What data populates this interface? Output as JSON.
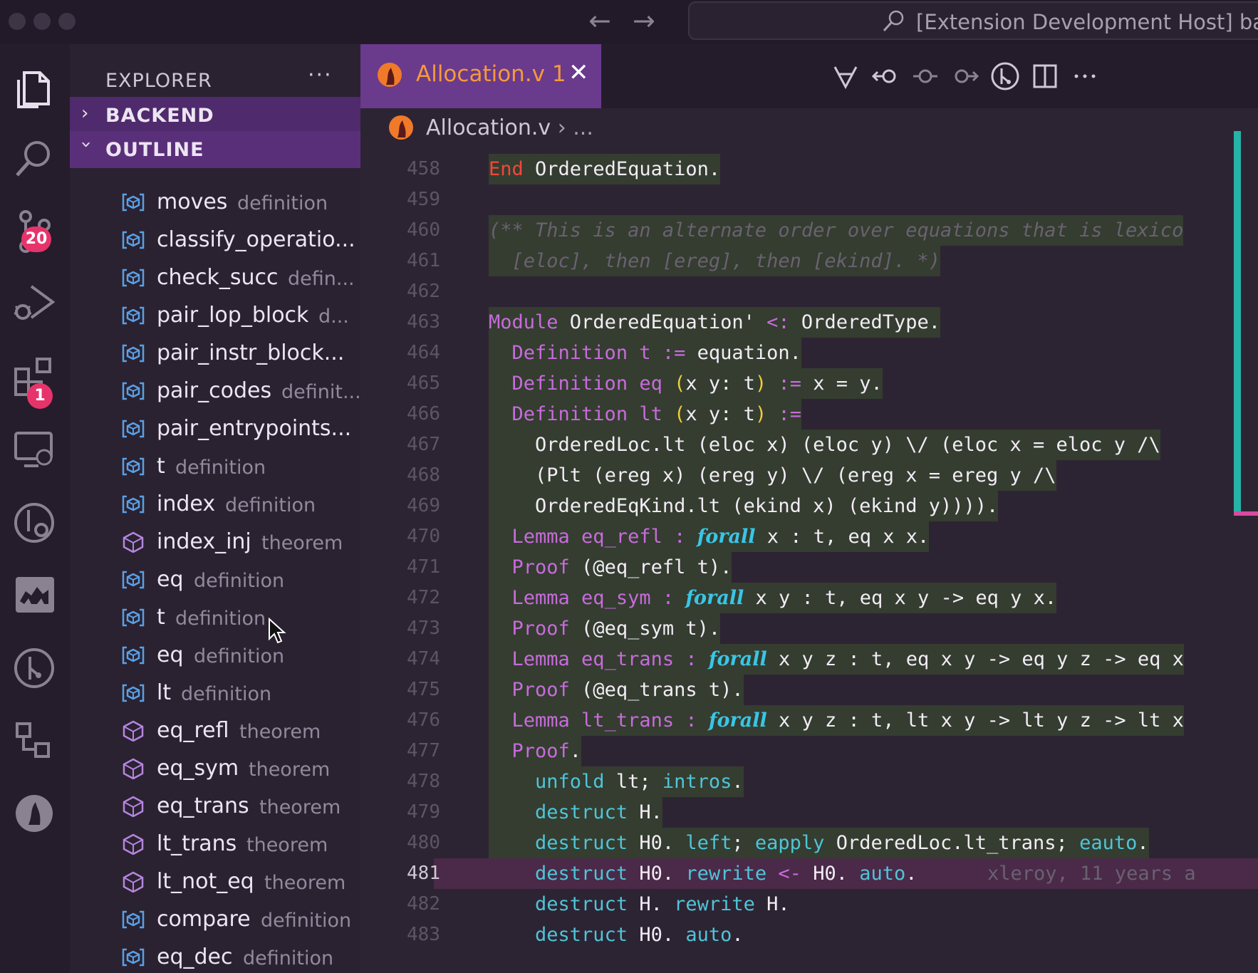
{
  "titlebar": {
    "window_title": "[Extension Development Host] back"
  },
  "activity": {
    "source_control_badge": "20",
    "extensions_badge": "1"
  },
  "sidebar": {
    "title": "EXPLORER",
    "more": "···",
    "backend_label": "BACKEND",
    "outline_label": "OUTLINE",
    "outline_items": [
      {
        "name": "moves",
        "kind": "definition",
        "icon": "definition-icon"
      },
      {
        "name": "classify_operatio...",
        "kind": "",
        "icon": "definition-icon"
      },
      {
        "name": "check_succ",
        "kind": "defin...",
        "icon": "definition-icon"
      },
      {
        "name": "pair_lop_block",
        "kind": "d...",
        "icon": "definition-icon"
      },
      {
        "name": "pair_instr_block...",
        "kind": "",
        "icon": "definition-icon"
      },
      {
        "name": "pair_codes",
        "kind": "definit...",
        "icon": "definition-icon"
      },
      {
        "name": "pair_entrypoints...",
        "kind": "",
        "icon": "definition-icon"
      },
      {
        "name": "t",
        "kind": "definition",
        "icon": "definition-icon"
      },
      {
        "name": "index",
        "kind": "definition",
        "icon": "definition-icon"
      },
      {
        "name": "index_inj",
        "kind": "theorem",
        "icon": "theorem-icon"
      },
      {
        "name": "eq",
        "kind": "definition",
        "icon": "definition-icon"
      },
      {
        "name": "t",
        "kind": "definition",
        "icon": "definition-icon"
      },
      {
        "name": "eq",
        "kind": "definition",
        "icon": "definition-icon"
      },
      {
        "name": "lt",
        "kind": "definition",
        "icon": "definition-icon"
      },
      {
        "name": "eq_refl",
        "kind": "theorem",
        "icon": "theorem-icon"
      },
      {
        "name": "eq_sym",
        "kind": "theorem",
        "icon": "theorem-icon"
      },
      {
        "name": "eq_trans",
        "kind": "theorem",
        "icon": "theorem-icon"
      },
      {
        "name": "lt_trans",
        "kind": "theorem",
        "icon": "theorem-icon"
      },
      {
        "name": "lt_not_eq",
        "kind": "theorem",
        "icon": "theorem-icon"
      },
      {
        "name": "compare",
        "kind": "definition",
        "icon": "definition-icon"
      },
      {
        "name": "eq_dec",
        "kind": "definition",
        "icon": "definition-icon"
      }
    ]
  },
  "editor": {
    "tab_label": "Allocation.v 1",
    "tab_close": "✕",
    "breadcrumb_file": "Allocation.v",
    "breadcrumb_rest": "›  ...",
    "current_line": 481,
    "blame": "xleroy, 11 years a",
    "lines": [
      {
        "n": "458"
      },
      {
        "n": "459"
      },
      {
        "n": "460"
      },
      {
        "n": "461"
      },
      {
        "n": "462"
      },
      {
        "n": "463"
      },
      {
        "n": "464"
      },
      {
        "n": "465"
      },
      {
        "n": "466"
      },
      {
        "n": "467"
      },
      {
        "n": "468"
      },
      {
        "n": "469"
      },
      {
        "n": "470"
      },
      {
        "n": "471"
      },
      {
        "n": "472"
      },
      {
        "n": "473"
      },
      {
        "n": "474"
      },
      {
        "n": "475"
      },
      {
        "n": "476"
      },
      {
        "n": "477"
      },
      {
        "n": "478"
      },
      {
        "n": "479"
      },
      {
        "n": "480"
      },
      {
        "n": "481"
      },
      {
        "n": "482"
      },
      {
        "n": "483"
      }
    ],
    "code": {
      "l458_kw": "End",
      "l458_rest": " OrderedEquation.",
      "l460": "(** This is an alternate order over equations that is lexico",
      "l461": "  [eloc], then [ereg], then [ekind]. *)",
      "l463_kw": "Module",
      "l463_a": " OrderedEquation' ",
      "l463_op": "<:",
      "l463_b": " OrderedType.",
      "def_kw": "Definition",
      "l464_name": " t ",
      "l464_op": ":=",
      "l464_rest": " equation.",
      "l465_name": " eq ",
      "l465_p1": "(",
      "l465_mid": "x y: t",
      "l465_p2": ")",
      "l465_op": " :=",
      "l465_rest": " x = y.",
      "l466_name": " lt ",
      "l466_p1": "(",
      "l466_mid": "x y: t",
      "l466_p2": ")",
      "l466_op": " :=",
      "l467": "OrderedLoc.lt (eloc x) (eloc y) \\/ (eloc x = eloc y /\\",
      "l468": "(Plt (ereg x) (ereg y) \\/ (ereg x = ereg y /\\",
      "l469": "OrderedEqKind.lt (ekind x) (ekind y)))).",
      "lemma_kw": "Lemma",
      "proof_kw": "Proof",
      "forall": "forall",
      "l470_name": " eq_refl ",
      "l470_rest": " x : t, eq x x.",
      "l471_rest": " (@eq_refl t).",
      "l472_name": " eq_sym ",
      "l472_rest": " x y : t, eq x y -> eq y x.",
      "l473_rest": " (@eq_sym t).",
      "l474_name": " eq_trans ",
      "l474_rest": " x y z : t, eq x y -> eq y z -> eq x",
      "l475_rest": " (@eq_trans t).",
      "l476_name": " lt_trans ",
      "l476_rest": " x y z : t, lt x y -> lt y z -> lt x",
      "l477_rest": ".",
      "l478_a": "unfold",
      "l478_b": " lt; ",
      "l478_c": "intros",
      "l478_d": ".",
      "destruct": "destruct",
      "l479_rest": " H.",
      "l480_a": " H0. ",
      "l480_b": "left",
      "l480_c": "; ",
      "l480_d": "eapply",
      "l480_e": " OrderedLoc.lt_trans; ",
      "l480_f": "eauto",
      "l480_g": ".",
      "l481_a": " H0. ",
      "l481_b": "rewrite",
      "l481_c": " <-",
      "l481_d": " H0. ",
      "l481_e": "auto",
      "l481_f": ".",
      "l482_a": " H. ",
      "l482_b": "rewrite",
      "l482_c": " H.",
      "l483_a": " H0. ",
      "l483_b": "auto",
      "l483_c": "."
    }
  }
}
